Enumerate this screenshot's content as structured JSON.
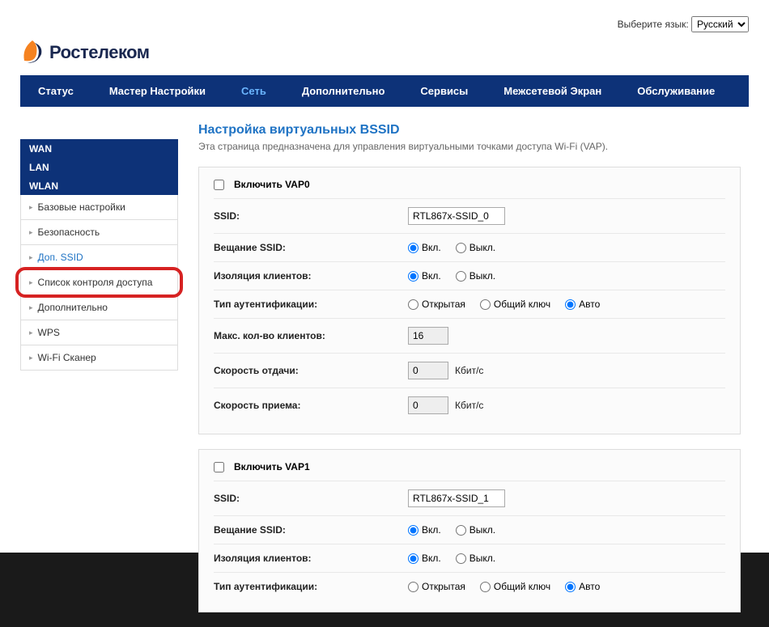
{
  "lang": {
    "label": "Выберите язык:",
    "value": "Русский"
  },
  "brand": "Ростелеком",
  "nav": [
    "Статус",
    "Мастер Настройки",
    "Сеть",
    "Дополнительно",
    "Сервисы",
    "Межсетевой Экран",
    "Обслуживание"
  ],
  "nav_active_index": 2,
  "sidebar": {
    "sections": [
      {
        "label": "WAN",
        "items": []
      },
      {
        "label": "LAN",
        "items": []
      },
      {
        "label": "WLAN",
        "items": [
          {
            "label": "Базовые настройки"
          },
          {
            "label": "Безопасность"
          },
          {
            "label": "Доп. SSID",
            "active": true
          },
          {
            "label": "Список контроля доступа",
            "highlighted": true
          },
          {
            "label": "Дополнительно"
          },
          {
            "label": "WPS"
          },
          {
            "label": "Wi-Fi Сканер"
          }
        ]
      }
    ]
  },
  "page": {
    "title": "Настройка виртуальных BSSID",
    "desc": "Эта страница предназначена для управления виртуальными точками доступа Wi-Fi (VAP)."
  },
  "labels": {
    "ssid": "SSID:",
    "broadcast_ssid": "Вещание SSID:",
    "client_isolation": "Изоляция клиентов:",
    "auth_type": "Тип аутентификации:",
    "max_clients": "Макс. кол-во клиентов:",
    "tx_rate": "Скорость отдачи:",
    "rx_rate": "Скорость приема:",
    "on": "Вкл.",
    "off": "Выкл.",
    "open": "Открытая",
    "shared": "Общий ключ",
    "auto": "Авто",
    "kbps": "Кбит/с"
  },
  "vaps": [
    {
      "enable_label": "Включить VAP0",
      "ssid": "RTL867x-SSID_0",
      "broadcast": "on",
      "isolation": "on",
      "auth": "auto",
      "max_clients": "16",
      "tx_rate": "0",
      "rx_rate": "0"
    },
    {
      "enable_label": "Включить VAP1",
      "ssid": "RTL867x-SSID_1",
      "broadcast": "on",
      "isolation": "on",
      "auth": "auto"
    }
  ]
}
